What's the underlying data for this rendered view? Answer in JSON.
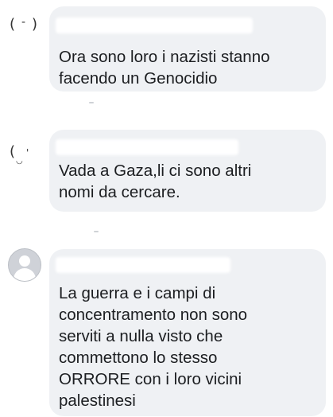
{
  "comments": [
    {
      "text": "Ora sono loro i nazisti stanno\nfacendo un Genocidio",
      "avatar_icon": "redacted-avatar-icon"
    },
    {
      "text": "Vada a Gaza,li ci sono altri\nnomi da cercare.",
      "avatar_icon": "redacted-avatar-icon"
    },
    {
      "text": "La guerra e i campi di\nconcentramento non sono\nserviti a nulla visto che\ncommettono lo stesso\nORRORE con i loro vicini\npalestinesi",
      "avatar_icon": "default-user-icon"
    }
  ],
  "colors": {
    "bubble": "#eff1f4",
    "text": "#1c1e21",
    "default_avatar": "#cfd2d8"
  }
}
